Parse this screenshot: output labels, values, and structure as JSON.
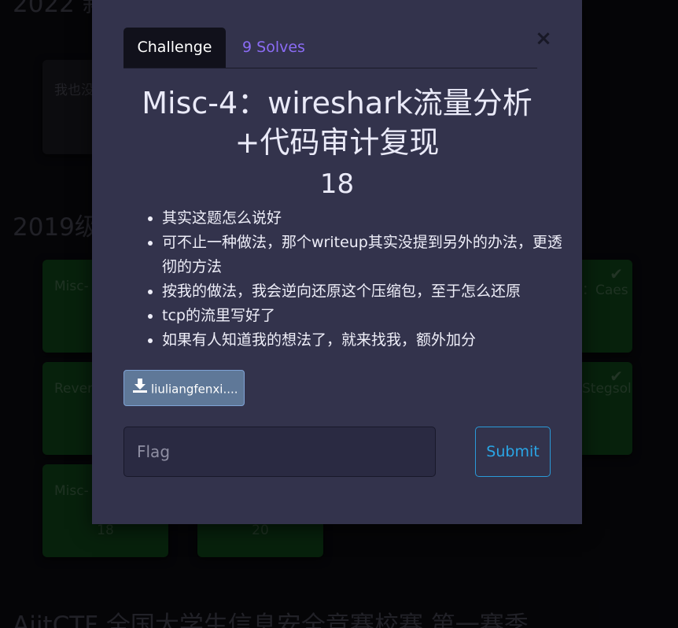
{
  "background": {
    "sections": [
      {
        "title": "2022 新生赛 ... 狂憨题"
      },
      {
        "title": "2019级 ..."
      },
      {
        "title": "AjitCTF 全国大学生信息安全竞赛校赛 第一赛季"
      }
    ],
    "cards": [
      {
        "name": "我也没",
        "points": ""
      },
      {
        "name": "Misc-",
        "points": ""
      },
      {
        "name": "：Caes",
        "points": ""
      },
      {
        "name": "Rever",
        "points": ""
      },
      {
        "name": "Stegsol",
        "points": ""
      },
      {
        "name": "Misc-",
        "points": "18"
      },
      {
        "name": "",
        "points": "20"
      }
    ],
    "check_glyph": "✔"
  },
  "modal": {
    "tabs": {
      "challenge": "Challenge",
      "solves": "9 Solves"
    },
    "close_glyph": "×",
    "title": "Misc-4：wireshark流量分析+代码审计复现",
    "points": "18",
    "description": [
      "其实这题怎么说好",
      "可不止一种做法，那个writeup其实没提到另外的办法，更透彻的方法",
      "按我的做法，我会逆向还原这个压缩包，至于怎么还原",
      "tcp的流里写好了",
      "如果有人知道我的想法了，就来找我，额外加分"
    ],
    "file": {
      "label": "liuliangfenxi....",
      "icon": "download-icon"
    },
    "flag_input": {
      "placeholder": "Flag",
      "value": ""
    },
    "submit_label": "Submit"
  },
  "colors": {
    "modal_bg": "#33334c",
    "tab_active_bg": "#11111b",
    "solves_link": "#8b6cf5",
    "submit_accent": "#2aa6e6",
    "file_button": "#5f7898",
    "solved_card": "#0e3d16"
  }
}
